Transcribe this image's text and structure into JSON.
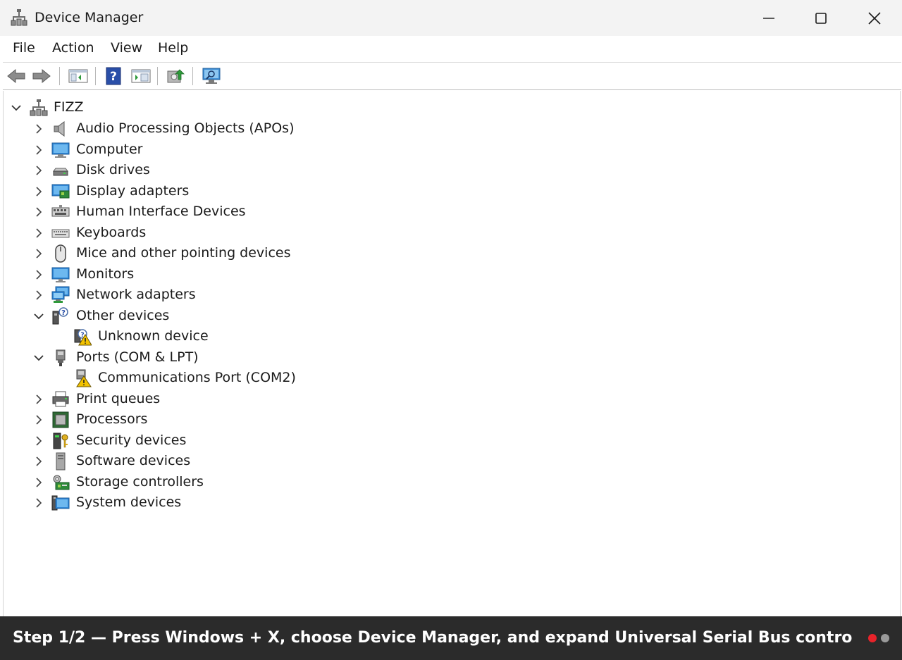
{
  "window": {
    "title": "Device Manager",
    "controls": [
      "minimize",
      "maximize",
      "close"
    ]
  },
  "menu": [
    {
      "label": "File"
    },
    {
      "label": "Action"
    },
    {
      "label": "View"
    },
    {
      "label": "Help"
    }
  ],
  "toolbar": {
    "buttons": [
      "back-icon",
      "forward-icon",
      "show-hide-console-tree-icon",
      "help-icon",
      "properties-icon",
      "update-driver-icon",
      "scan-hardware-changes-icon"
    ]
  },
  "tree": {
    "root": {
      "label": "FIZZ",
      "expanded": true
    },
    "items": [
      {
        "label": "Audio Processing Objects (APOs)",
        "icon": "speaker-icon",
        "expanded": false
      },
      {
        "label": "Computer",
        "icon": "computer-icon",
        "expanded": false
      },
      {
        "label": "Disk drives",
        "icon": "disk-drive-icon",
        "expanded": false
      },
      {
        "label": "Display adapters",
        "icon": "display-adapter-icon",
        "expanded": false
      },
      {
        "label": "Human Interface Devices",
        "icon": "hid-icon",
        "expanded": false
      },
      {
        "label": "Keyboards",
        "icon": "keyboard-icon",
        "expanded": false
      },
      {
        "label": "Mice and other pointing devices",
        "icon": "mouse-icon",
        "expanded": false
      },
      {
        "label": "Monitors",
        "icon": "monitor-icon",
        "expanded": false
      },
      {
        "label": "Network adapters",
        "icon": "network-adapter-icon",
        "expanded": false
      },
      {
        "label": "Other devices",
        "icon": "other-devices-icon",
        "expanded": true,
        "children": [
          {
            "label": "Unknown device",
            "icon": "unknown-device-warning-icon"
          }
        ]
      },
      {
        "label": "Ports (COM & LPT)",
        "icon": "port-icon",
        "expanded": true,
        "children": [
          {
            "label": "Communications Port (COM2)",
            "icon": "port-warning-icon"
          }
        ]
      },
      {
        "label": "Print queues",
        "icon": "printer-icon",
        "expanded": false
      },
      {
        "label": "Processors",
        "icon": "processor-icon",
        "expanded": false
      },
      {
        "label": "Security devices",
        "icon": "security-device-icon",
        "expanded": false
      },
      {
        "label": "Software devices",
        "icon": "software-device-icon",
        "expanded": false
      },
      {
        "label": "Storage controllers",
        "icon": "storage-controller-icon",
        "expanded": false
      },
      {
        "label": "System devices",
        "icon": "system-devices-icon",
        "expanded": false
      }
    ]
  },
  "caption": {
    "text": "Step 1/2 — Press Windows + X, choose Device Manager, and expand Universal Serial Bus contro",
    "step_current": 1,
    "step_total": 2,
    "dot_colors": [
      "#e8232a",
      "#9a9a9a"
    ]
  }
}
